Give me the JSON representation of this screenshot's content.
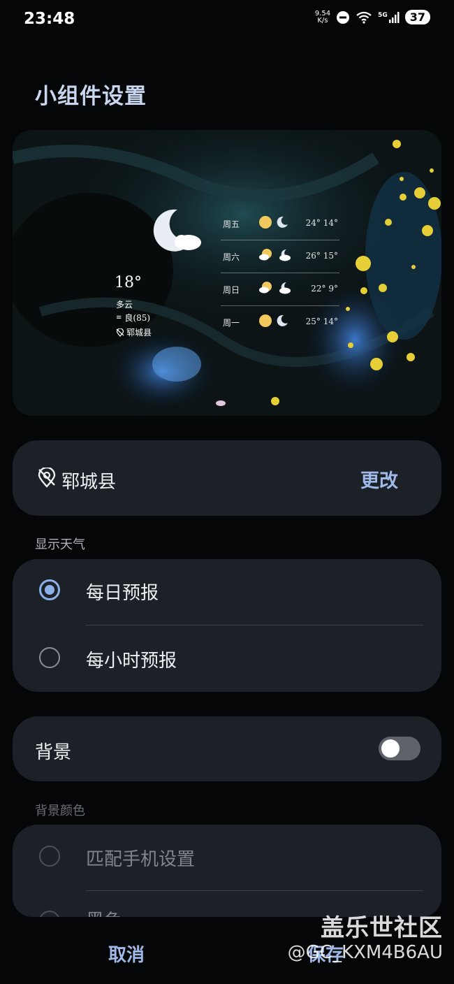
{
  "status_bar": {
    "time": "23:48",
    "net_speed_value": "9.54",
    "net_speed_unit": "K/s",
    "network_type": "5G",
    "battery": "37"
  },
  "page": {
    "title": "小组件设置"
  },
  "widget_preview": {
    "current_temp": "18°",
    "condition": "多云",
    "aqi": "良(85)",
    "location": "郓城县",
    "forecast": [
      {
        "day": "周五",
        "temps": "24° 14°",
        "icon_day": "sun-icon",
        "icon_night": "moon-icon"
      },
      {
        "day": "周六",
        "temps": "26° 15°",
        "icon_day": "partly-cloudy-icon",
        "icon_night": "cloudy-night-icon"
      },
      {
        "day": "周日",
        "temps": "22° 9°",
        "icon_day": "partly-cloudy-icon",
        "icon_night": "cloudy-night-icon"
      },
      {
        "day": "周一",
        "temps": "25° 14°",
        "icon_day": "sun-icon",
        "icon_night": "moon-icon"
      }
    ]
  },
  "location_card": {
    "name": "郓城县",
    "change_label": "更改"
  },
  "display_weather": {
    "label": "显示天气",
    "options": [
      {
        "label": "每日预报",
        "selected": true
      },
      {
        "label": "每小时预报",
        "selected": false
      }
    ]
  },
  "background": {
    "label": "背景",
    "enabled": false
  },
  "background_color": {
    "label": "背景颜色",
    "options": [
      {
        "label": "匹配手机设置",
        "selected": false,
        "enabled": false
      },
      {
        "label": "黑色",
        "selected": false,
        "enabled": false
      }
    ]
  },
  "bottom_bar": {
    "cancel_label": "取消",
    "save_label": "保存"
  },
  "watermark": {
    "line1": "盖乐世社区",
    "line2": "@GC_KXM4B6AU"
  },
  "colors": {
    "accent": "#8db0ea",
    "card_bg": "#1c2127",
    "page_bg": "#050607"
  }
}
